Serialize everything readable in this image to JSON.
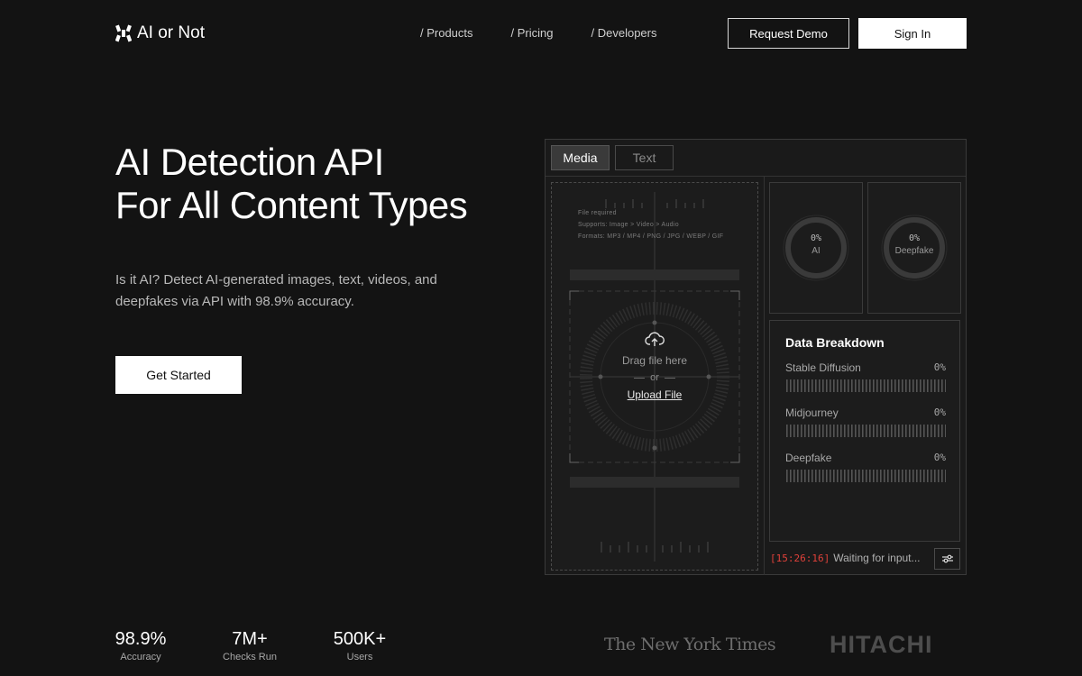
{
  "nav": {
    "logo_text": "AI or Not",
    "links": [
      "/ Products",
      "/ Pricing",
      "/ Developers"
    ],
    "request_demo": "Request Demo",
    "sign_in": "Sign In"
  },
  "hero": {
    "title_line1": "AI Detection API",
    "title_line2": "For All Content Types",
    "description": "Is it AI? Detect AI-generated images, text, videos, and deepfakes via API with 98.9% accuracy.",
    "cta": "Get Started"
  },
  "stats": [
    {
      "value": "98.9%",
      "label": "Accuracy"
    },
    {
      "value": "7M+",
      "label": "Checks Run"
    },
    {
      "value": "500K+",
      "label": "Users"
    }
  ],
  "logos": {
    "nyt": "The New York Times",
    "hitachi": "HITACHI"
  },
  "panel": {
    "tabs": {
      "media": "Media",
      "text": "Text"
    },
    "upload": {
      "file_required": "File required",
      "supports": "Supports: Image > Video > Audio",
      "formats": "Formats: MP3 / MP4 / PNG / JPG / WEBP / GIF",
      "drag_text": "Drag file here",
      "or_text": "or",
      "upload_link": "Upload File"
    },
    "gauges": [
      {
        "value": "0%",
        "label": "AI"
      },
      {
        "value": "0%",
        "label": "Deepfake"
      }
    ],
    "breakdown": {
      "title": "Data Breakdown",
      "rows": [
        {
          "name": "Stable Diffusion",
          "value": "0%"
        },
        {
          "name": "Midjourney",
          "value": "0%"
        },
        {
          "name": "Deepfake",
          "value": "0%"
        }
      ]
    },
    "status": {
      "time": "[15:26:16]",
      "message": "Waiting for input..."
    }
  },
  "colors": {
    "status_time": "#e0413a",
    "background": "#131313"
  }
}
